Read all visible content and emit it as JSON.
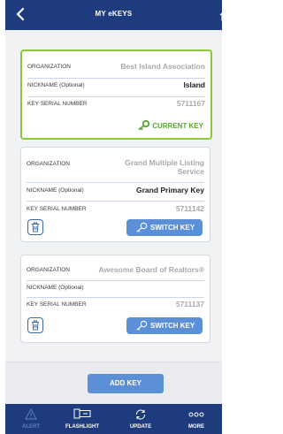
{
  "header": {
    "title": "MY eKEYS"
  },
  "cards": [
    {
      "organization_label": "ORGANIZATION",
      "organization": "Best Island Association",
      "nickname_label": "NICKNAME (Optional)",
      "nickname": "Island",
      "serial_label": "KEY SERIAL NUMBER",
      "serial": "5711167",
      "status": "CURRENT KEY"
    },
    {
      "organization_label": "ORGANIZATION",
      "organization_line1": "Grand Multiple Listing",
      "organization_line2": "Service",
      "nickname_label": "NICKNAME (Optional)",
      "nickname": "Grand Primary Key",
      "serial_label": "KEY SERIAL NUMBER",
      "serial": "5711142",
      "action": "SWITCH KEY"
    },
    {
      "organization_label": "ORGANIZATION",
      "organization": "Awesome Board of Realtors®",
      "nickname_label": "NICKNAME (Optional)",
      "nickname": "",
      "serial_label": "KEY SERIAL NUMBER",
      "serial": "5711137",
      "action": "SWITCH KEY"
    }
  ],
  "add_key": "ADD KEY",
  "tabs": [
    {
      "label": "ALERT",
      "icon": "alert-icon"
    },
    {
      "label": "FLASHLIGHT",
      "icon": "flashlight-icon"
    },
    {
      "label": "UPDATE",
      "icon": "update-icon"
    },
    {
      "label": "MORE",
      "icon": "more-icon"
    }
  ],
  "colors": {
    "header": "#1e3c7d",
    "accent_blue": "#5b8fd6",
    "active_green": "#8cc63f",
    "current_key_green": "#5aa531"
  }
}
